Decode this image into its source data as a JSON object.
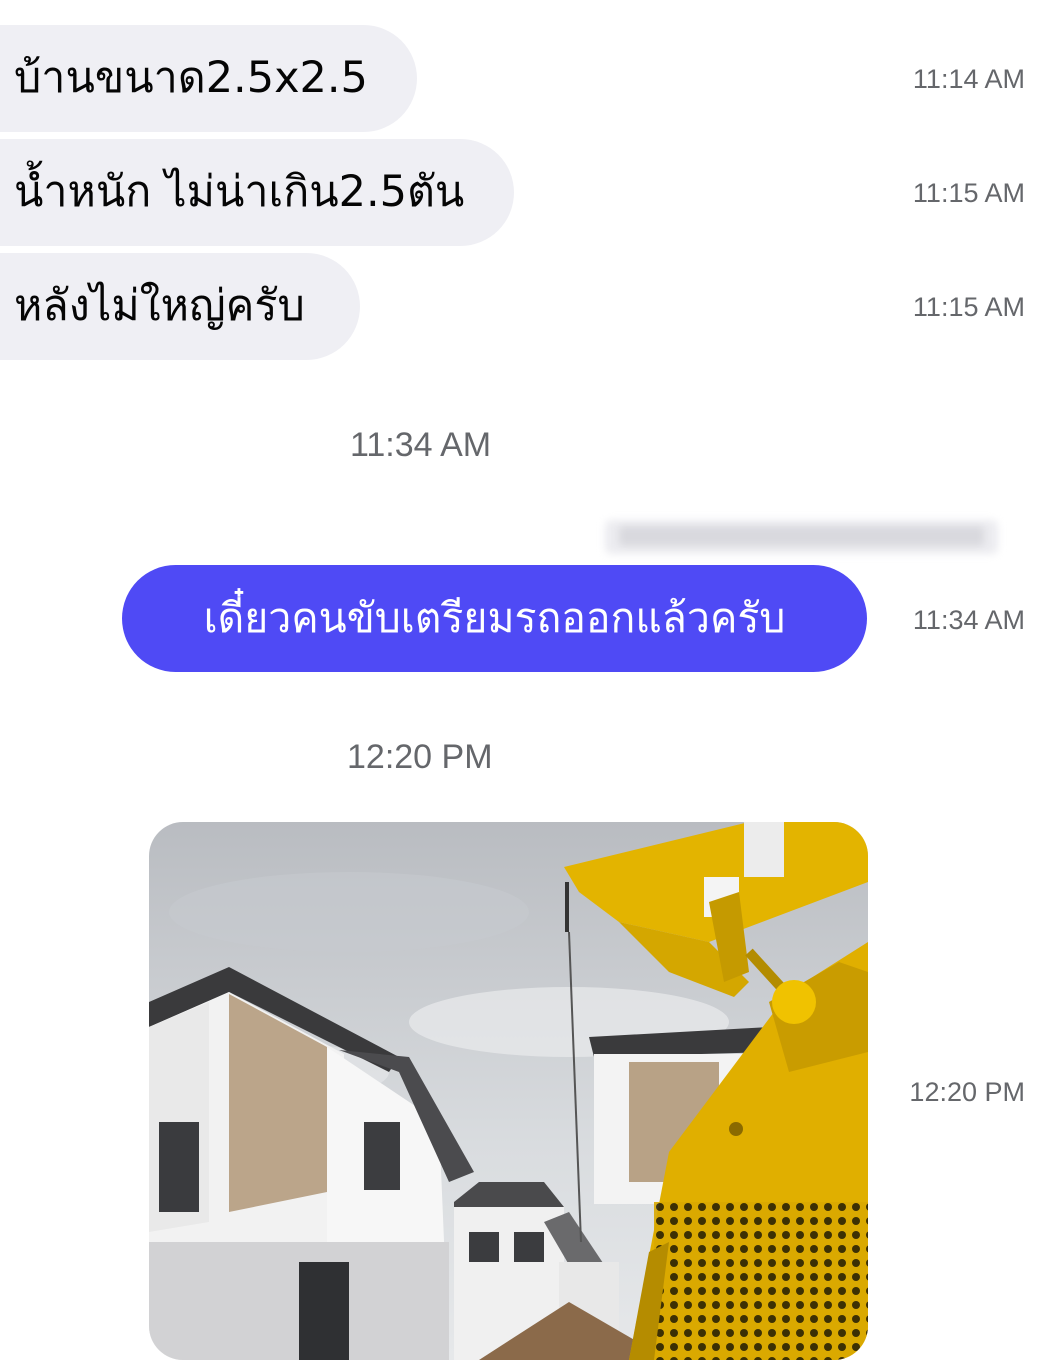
{
  "messages_received": [
    {
      "text": "บ้านขนาด2.5x2.5",
      "time": "11:14 AM"
    },
    {
      "text": "น้ำหนัก ไม่น่าเกิน2.5ตัน",
      "time": "11:15 AM"
    },
    {
      "text": "หลังไม่ใหญ่ครับ",
      "time": "11:15 AM"
    }
  ],
  "separator_1": "11:34 AM",
  "message_sent": {
    "text": "เดี๋ยวคนขับเตรียมรถออกแล้วครับ",
    "time": "11:34 AM"
  },
  "separator_2": "12:20 PM",
  "photo_message": {
    "time": "12:20 PM"
  },
  "colors": {
    "incoming_bubble": "#efeff4",
    "outgoing_bubble": "#4f4af5",
    "timestamp": "#65676b"
  }
}
